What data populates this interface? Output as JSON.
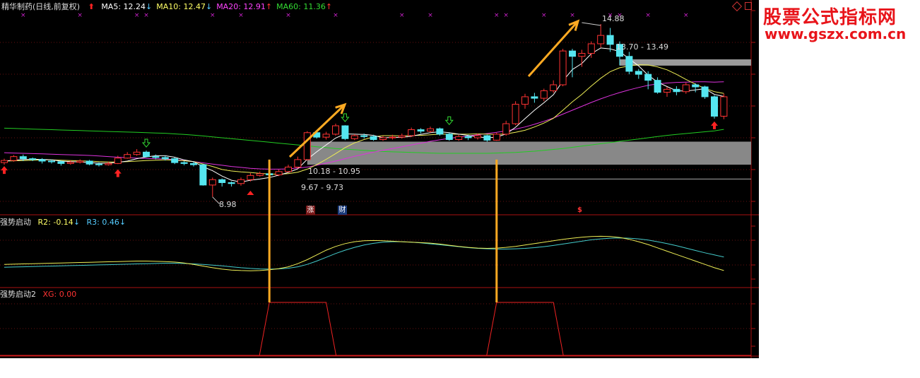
{
  "main_panel": {
    "stock_name": "精华制药",
    "period_label": "(日线,前复权)",
    "ma": [
      {
        "label": "MA5: 12.24",
        "color": "#ffffff",
        "arrow": "↓",
        "arrow_color": "#55ccff"
      },
      {
        "label": "MA10: 12.47",
        "color": "#ffff66",
        "arrow": "↓",
        "arrow_color": "#55ccff"
      },
      {
        "label": "MA20: 12.91",
        "color": "#ff44ff",
        "arrow": "↑",
        "arrow_color": "#ff3333"
      },
      {
        "label": "MA60: 11.36",
        "color": "#33dd33",
        "arrow": "↑",
        "arrow_color": "#ff3333"
      }
    ],
    "annotations": {
      "high_label": "14.88",
      "range_upper": "13.70 - 13.49",
      "range_lower": "10.18 - 10.95",
      "range_bottom": "9.67 - 9.73",
      "low_label": "8.98"
    },
    "badges": {
      "zhang": "涨",
      "cai": "财",
      "dollar": "$"
    }
  },
  "sub_panel_1": {
    "title": "强势启动",
    "r2_label": "R2: -0.14",
    "r2_arrow": "↓",
    "r3_label": "R3: 0.46",
    "r3_arrow": "↓"
  },
  "sub_panel_2": {
    "title": "强势启动2",
    "xg_label": "XG: 0.00"
  },
  "watermark": {
    "title_cn": "股票公式指标网",
    "url": "www.gszx.com.cn"
  },
  "chart_data": {
    "type": "candlestick",
    "candles": [
      [
        10.25,
        10.32,
        10.38,
        10.18
      ],
      [
        10.32,
        10.45,
        10.5,
        10.28
      ],
      [
        10.45,
        10.38,
        10.52,
        10.3
      ],
      [
        10.38,
        10.35,
        10.42,
        10.3
      ],
      [
        10.35,
        10.3,
        10.4,
        10.22
      ],
      [
        10.3,
        10.28,
        10.36,
        10.22
      ],
      [
        10.28,
        10.22,
        10.32,
        10.15
      ],
      [
        10.22,
        10.26,
        10.32,
        10.18
      ],
      [
        10.26,
        10.3,
        10.36,
        10.22
      ],
      [
        10.3,
        10.2,
        10.34,
        10.16
      ],
      [
        10.2,
        10.18,
        10.26,
        10.12
      ],
      [
        10.18,
        10.22,
        10.28,
        10.15
      ],
      [
        10.22,
        10.4,
        10.48,
        10.2
      ],
      [
        10.4,
        10.52,
        10.6,
        10.38
      ],
      [
        10.52,
        10.6,
        10.7,
        10.48
      ],
      [
        10.6,
        10.45,
        10.65,
        10.42
      ],
      [
        10.45,
        10.42,
        10.52,
        10.36
      ],
      [
        10.42,
        10.38,
        10.48,
        10.32
      ],
      [
        10.38,
        10.25,
        10.42,
        10.2
      ],
      [
        10.25,
        10.22,
        10.3,
        10.16
      ],
      [
        10.22,
        10.18,
        10.28,
        10.12
      ],
      [
        10.18,
        9.5,
        10.18,
        9.48
      ],
      [
        9.5,
        9.68,
        9.75,
        9.1
      ],
      [
        9.68,
        9.58,
        9.72,
        9.45
      ],
      [
        9.58,
        9.55,
        9.62,
        9.45
      ],
      [
        9.55,
        9.68,
        9.75,
        9.48
      ],
      [
        9.68,
        9.82,
        9.9,
        9.62
      ],
      [
        9.82,
        9.88,
        9.95,
        9.78
      ],
      [
        9.88,
        9.84,
        9.95,
        9.78
      ],
      [
        9.84,
        9.95,
        10.02,
        9.8
      ],
      [
        9.95,
        10.1,
        10.18,
        9.92
      ],
      [
        10.1,
        10.35,
        10.45,
        10.05
      ],
      [
        10.35,
        11.25,
        11.3,
        10.33
      ],
      [
        11.25,
        11.1,
        11.32,
        11.05
      ],
      [
        11.1,
        11.2,
        11.28,
        11.02
      ],
      [
        11.2,
        11.48,
        11.55,
        11.15
      ],
      [
        11.48,
        11.05,
        11.5,
        11.0
      ],
      [
        11.05,
        11.15,
        11.2,
        11.0
      ],
      [
        11.15,
        11.12,
        11.22,
        11.05
      ],
      [
        11.12,
        11.02,
        11.18,
        10.98
      ],
      [
        11.02,
        11.08,
        11.14,
        10.98
      ],
      [
        11.08,
        11.1,
        11.18,
        11.02
      ],
      [
        11.1,
        11.15,
        11.22,
        11.05
      ],
      [
        11.15,
        11.35,
        11.42,
        11.1
      ],
      [
        11.35,
        11.3,
        11.4,
        11.22
      ],
      [
        11.3,
        11.38,
        11.45,
        11.25
      ],
      [
        11.38,
        11.2,
        11.42,
        11.15
      ],
      [
        11.2,
        11.02,
        11.25,
        10.98
      ],
      [
        11.02,
        11.12,
        11.18,
        10.98
      ],
      [
        11.12,
        11.08,
        11.18,
        11.0
      ],
      [
        11.08,
        11.15,
        11.22,
        11.02
      ],
      [
        11.15,
        11.0,
        11.18,
        10.95
      ],
      [
        11.0,
        11.2,
        11.25,
        10.98
      ],
      [
        11.2,
        11.55,
        11.65,
        11.15
      ],
      [
        11.55,
        12.2,
        12.3,
        11.5
      ],
      [
        12.2,
        12.45,
        12.55,
        12.05
      ],
      [
        12.45,
        12.4,
        12.58,
        12.25
      ],
      [
        12.4,
        12.65,
        12.72,
        12.3
      ],
      [
        12.65,
        12.85,
        13.0,
        12.58
      ],
      [
        12.85,
        13.98,
        14.05,
        12.8
      ],
      [
        13.98,
        13.8,
        14.05,
        13.1
      ],
      [
        13.8,
        13.9,
        14.02,
        13.45
      ],
      [
        13.9,
        14.22,
        14.3,
        13.75
      ],
      [
        14.22,
        14.5,
        14.88,
        14.1
      ],
      [
        14.5,
        14.2,
        14.75,
        13.95
      ],
      [
        14.2,
        13.8,
        14.3,
        13.5
      ],
      [
        13.8,
        13.3,
        13.95,
        13.2
      ],
      [
        13.3,
        13.2,
        13.38,
        13.05
      ],
      [
        13.2,
        13.0,
        13.3,
        12.7
      ],
      [
        13.0,
        12.6,
        13.1,
        12.55
      ],
      [
        12.6,
        12.7,
        12.78,
        12.45
      ],
      [
        12.7,
        12.62,
        12.8,
        12.5
      ],
      [
        12.62,
        12.85,
        12.92,
        12.55
      ],
      [
        12.85,
        12.78,
        12.9,
        12.6
      ],
      [
        12.78,
        12.45,
        12.82,
        12.38
      ],
      [
        12.45,
        11.8,
        12.5,
        11.72
      ],
      [
        11.8,
        12.45,
        12.55,
        11.7
      ]
    ],
    "ma5": [
      10.3,
      10.33,
      10.35,
      10.36,
      10.36,
      10.34,
      10.3,
      10.28,
      10.27,
      10.25,
      10.23,
      10.23,
      10.26,
      10.3,
      10.38,
      10.44,
      10.48,
      10.48,
      10.43,
      10.34,
      10.28,
      10.11,
      9.98,
      9.8,
      9.66,
      9.6,
      9.66,
      9.7,
      9.75,
      9.83,
      9.92,
      10.04,
      10.36,
      10.61,
      10.84,
      11.07,
      11.21,
      11.2,
      11.19,
      11.16,
      11.08,
      11.09,
      11.09,
      11.13,
      11.19,
      11.25,
      11.28,
      11.25,
      11.2,
      11.16,
      11.11,
      11.08,
      11.1,
      11.21,
      11.43,
      11.72,
      12.0,
      12.25,
      12.52,
      12.98,
      13.36,
      13.56,
      13.89,
      14.08,
      14.05,
      13.96,
      13.72,
      13.48,
      13.17,
      12.94,
      12.79,
      12.65,
      12.64,
      12.68,
      12.72,
      12.53,
      12.46
    ],
    "ma10": [
      10.3,
      10.31,
      10.32,
      10.33,
      10.34,
      10.34,
      10.33,
      10.32,
      10.31,
      10.3,
      10.28,
      10.27,
      10.27,
      10.28,
      10.3,
      10.32,
      10.33,
      10.34,
      10.33,
      10.31,
      10.28,
      10.2,
      10.12,
      10.02,
      9.97,
      9.94,
      9.92,
      9.89,
      9.87,
      9.86,
      9.88,
      9.93,
      10.03,
      10.18,
      10.36,
      10.55,
      10.75,
      10.91,
      11.02,
      11.11,
      11.15,
      11.15,
      11.14,
      11.16,
      11.16,
      11.18,
      11.2,
      11.2,
      11.2,
      11.2,
      11.21,
      11.2,
      11.19,
      11.21,
      11.26,
      11.33,
      11.44,
      11.57,
      11.73,
      12.0,
      12.28,
      12.53,
      12.81,
      13.07,
      13.29,
      13.42,
      13.48,
      13.52,
      13.51,
      13.45,
      13.35,
      13.2,
      13.03,
      12.87,
      12.73,
      12.62,
      12.56
    ],
    "ma20": [
      10.58,
      10.57,
      10.56,
      10.55,
      10.54,
      10.53,
      10.52,
      10.51,
      10.5,
      10.49,
      10.47,
      10.45,
      10.43,
      10.41,
      10.4,
      10.39,
      10.38,
      10.37,
      10.35,
      10.32,
      10.28,
      10.24,
      10.2,
      10.16,
      10.12,
      10.09,
      10.06,
      10.04,
      10.03,
      10.03,
      10.04,
      10.07,
      10.1,
      10.16,
      10.23,
      10.3,
      10.38,
      10.46,
      10.53,
      10.6,
      10.66,
      10.72,
      10.78,
      10.84,
      10.9,
      10.96,
      11.01,
      11.06,
      11.1,
      11.14,
      11.18,
      11.22,
      11.26,
      11.31,
      11.37,
      11.44,
      11.53,
      11.63,
      11.74,
      11.87,
      12.0,
      12.13,
      12.26,
      12.38,
      12.49,
      12.59,
      12.68,
      12.76,
      12.83,
      12.88,
      12.91,
      12.93,
      12.94,
      12.95,
      12.95,
      12.94,
      12.95
    ],
    "ma60": [
      11.4,
      11.39,
      11.38,
      11.37,
      11.36,
      11.35,
      11.34,
      11.33,
      11.32,
      11.31,
      11.3,
      11.29,
      11.28,
      11.27,
      11.26,
      11.25,
      11.24,
      11.23,
      11.21,
      11.19,
      11.17,
      11.14,
      11.11,
      11.08,
      11.05,
      11.02,
      10.99,
      10.96,
      10.93,
      10.9,
      10.87,
      10.84,
      10.81,
      10.78,
      10.75,
      10.72,
      10.7,
      10.68,
      10.66,
      10.64,
      10.62,
      10.61,
      10.6,
      10.59,
      10.58,
      10.57,
      10.56,
      10.56,
      10.56,
      10.56,
      10.56,
      10.56,
      10.57,
      10.58,
      10.59,
      10.61,
      10.63,
      10.66,
      10.69,
      10.72,
      10.76,
      10.8,
      10.84,
      10.88,
      10.92,
      10.96,
      11.0,
      11.04,
      11.08,
      11.12,
      11.16,
      11.19,
      11.22,
      11.25,
      11.28,
      11.31,
      11.36
    ],
    "r2": [
      0.52,
      0.53,
      0.54,
      0.55,
      0.56,
      0.57,
      0.58,
      0.59,
      0.6,
      0.61,
      0.62,
      0.63,
      0.64,
      0.65,
      0.66,
      0.66,
      0.65,
      0.64,
      0.62,
      0.58,
      0.52,
      0.45,
      0.38,
      0.32,
      0.28,
      0.26,
      0.25,
      0.26,
      0.29,
      0.34,
      0.42,
      0.55,
      0.72,
      0.92,
      1.12,
      1.28,
      1.4,
      1.48,
      1.52,
      1.53,
      1.52,
      1.5,
      1.48,
      1.46,
      1.44,
      1.42,
      1.38,
      1.33,
      1.28,
      1.24,
      1.21,
      1.2,
      1.21,
      1.24,
      1.28,
      1.34,
      1.4,
      1.46,
      1.52,
      1.58,
      1.63,
      1.67,
      1.7,
      1.71,
      1.7,
      1.66,
      1.58,
      1.48,
      1.36,
      1.22,
      1.08,
      0.94,
      0.8,
      0.66,
      0.52,
      0.38,
      0.26
    ],
    "r3": [
      0.4,
      0.41,
      0.42,
      0.43,
      0.44,
      0.45,
      0.46,
      0.47,
      0.48,
      0.49,
      0.5,
      0.51,
      0.52,
      0.53,
      0.54,
      0.55,
      0.56,
      0.57,
      0.57,
      0.56,
      0.54,
      0.52,
      0.49,
      0.46,
      0.42,
      0.38,
      0.35,
      0.33,
      0.32,
      0.33,
      0.36,
      0.42,
      0.52,
      0.66,
      0.82,
      0.98,
      1.12,
      1.24,
      1.34,
      1.41,
      1.46,
      1.48,
      1.48,
      1.46,
      1.43,
      1.39,
      1.35,
      1.31,
      1.27,
      1.23,
      1.2,
      1.18,
      1.17,
      1.17,
      1.18,
      1.2,
      1.23,
      1.27,
      1.32,
      1.38,
      1.44,
      1.5,
      1.56,
      1.6,
      1.63,
      1.64,
      1.63,
      1.6,
      1.55,
      1.48,
      1.4,
      1.31,
      1.21,
      1.11,
      1.01,
      0.92,
      0.83
    ],
    "xg_segments": [
      [
        28,
        34
      ],
      [
        52,
        58
      ]
    ]
  }
}
